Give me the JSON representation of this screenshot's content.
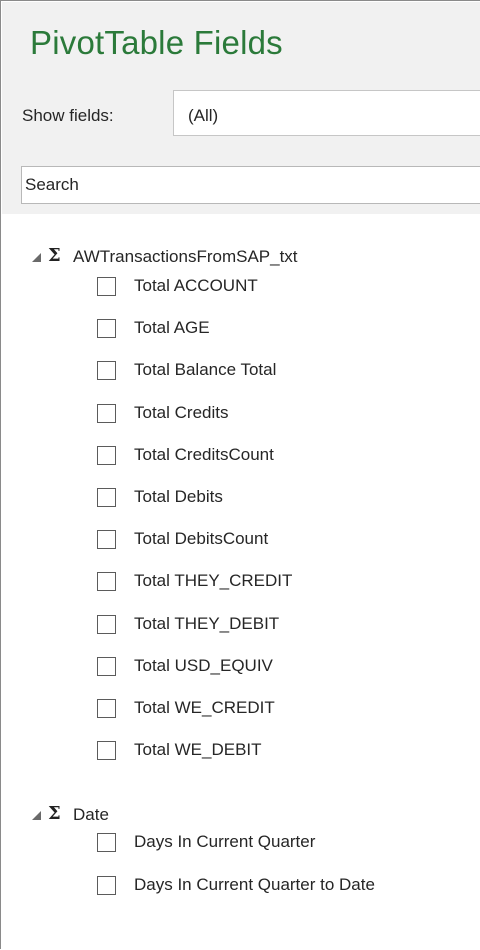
{
  "pane": {
    "title": "PivotTable Fields",
    "show_fields_label": "Show fields:",
    "show_fields_value": "(All)",
    "search_placeholder": "Search"
  },
  "groups": [
    {
      "name": "AWTransactionsFromSAP_txt",
      "icon": "sigma-icon",
      "fields": [
        "Total ACCOUNT",
        "Total AGE",
        "Total Balance Total",
        "Total Credits",
        "Total CreditsCount",
        "Total Debits",
        "Total DebitsCount",
        "Total THEY_CREDIT",
        "Total THEY_DEBIT",
        "Total USD_EQUIV",
        "Total WE_CREDIT",
        "Total WE_DEBIT"
      ]
    },
    {
      "name": "Date",
      "icon": "sigma-icon",
      "fields": [
        "Days In Current Quarter",
        "Days In Current Quarter to Date"
      ]
    }
  ],
  "colors": {
    "title": "#2b7a3a",
    "header_bg": "#f1f1f1"
  }
}
